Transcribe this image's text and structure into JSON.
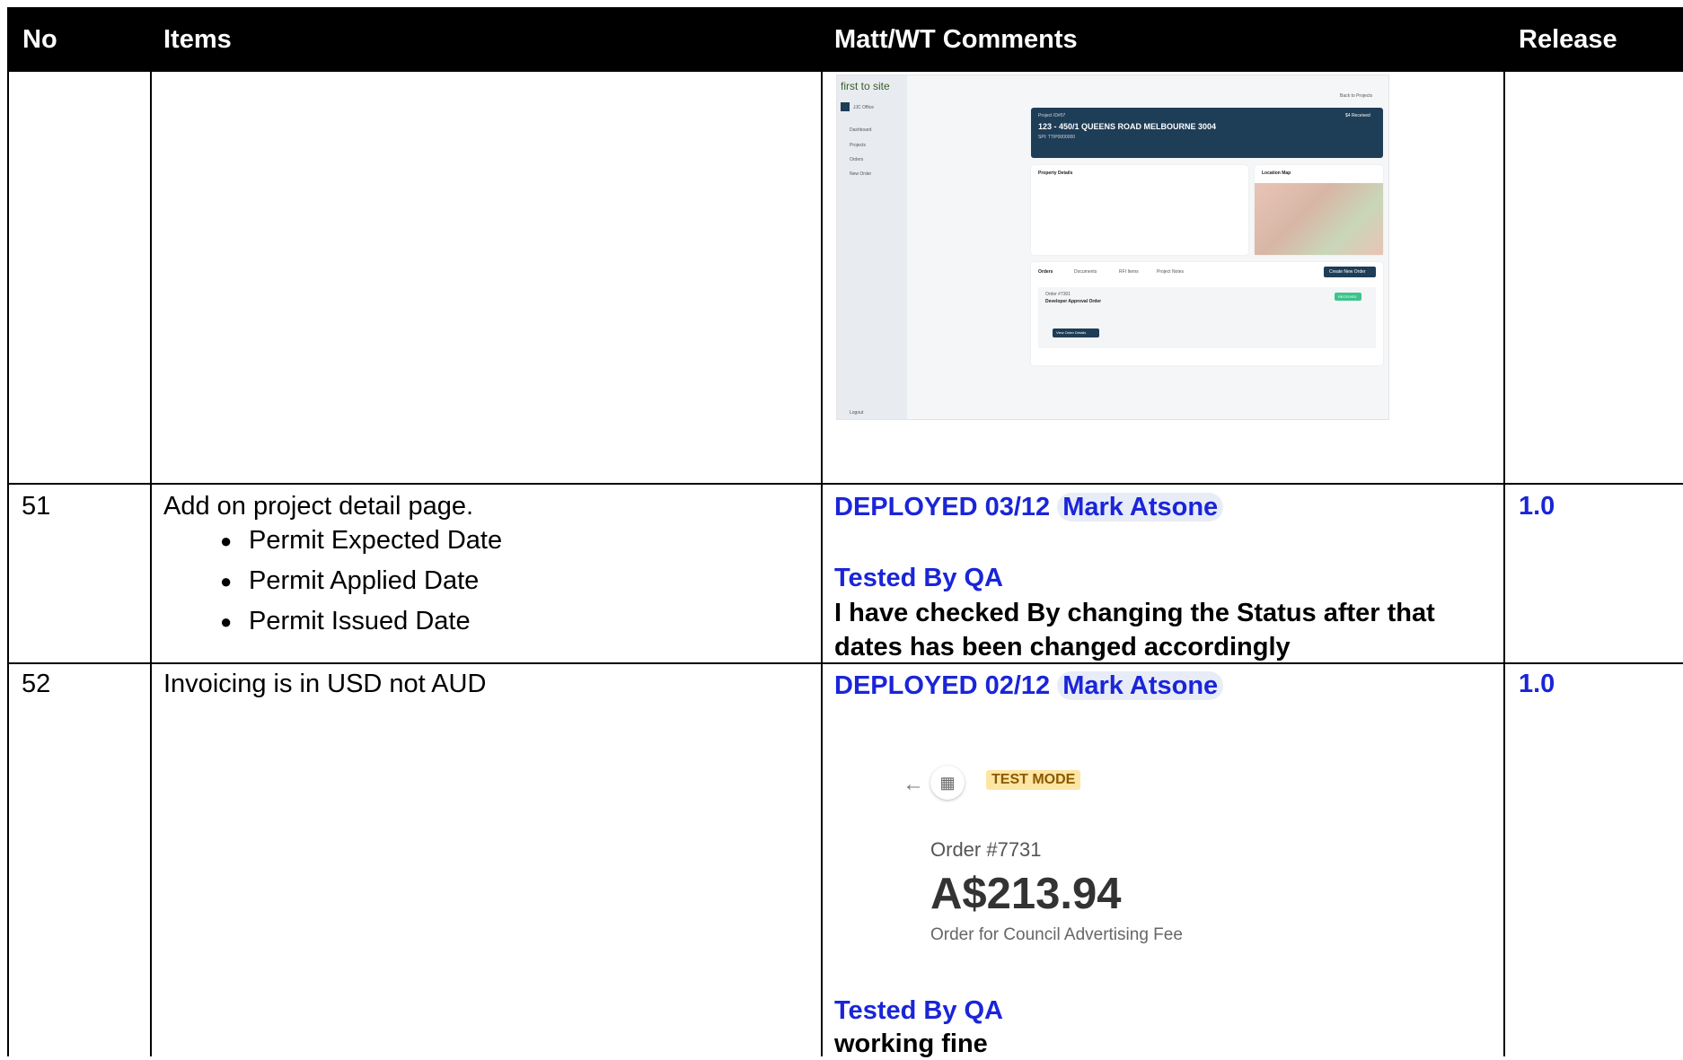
{
  "header": {
    "no": "No",
    "items": "Items",
    "comments": "Matt/WT Comments",
    "release": "Release"
  },
  "screenshot": {
    "brand": "first to site",
    "org": "JJC Office",
    "nav": [
      "Dashboard",
      "Projects",
      "Orders",
      "New Order"
    ],
    "logout": "Logout",
    "back": "Back to Projects",
    "project_label": "Project ID#07",
    "project_title": "123 - 450/1 QUEENS ROAD MELBOURNE 3004",
    "project_sub": "SPI: TTIP0000000",
    "received": "$4 Received",
    "property_details": "Property Details",
    "location_map": "Location Map",
    "tabs": [
      "Orders",
      "Documents",
      "RFI Items",
      "Project Notes"
    ],
    "create_order": "Create New Order",
    "order_label": "Order #7301",
    "order_name": "Developer Approval Order",
    "status": "RECEIVED",
    "view_order": "View Order Details"
  },
  "rows": [
    {
      "no": "51",
      "item_title": "Add on project detail page.",
      "bullets": [
        "Permit Expected Date",
        "Permit Applied Date",
        "Permit Issued Date"
      ],
      "deployed": "DEPLOYED 03/12",
      "person": "Mark Atsone",
      "tested": "Tested By QA",
      "comment": "I have checked By changing the Status after that dates has been changed accordingly",
      "release": "1.0"
    },
    {
      "no": "52",
      "item_title": "Invoicing is in USD not AUD",
      "deployed": "DEPLOYED 02/12",
      "person": "Mark Atsone",
      "tested": "Tested By QA",
      "comment": "working fine",
      "release": "1.0"
    }
  ],
  "payment": {
    "back_icon": "arrow-left-icon",
    "store_icon": "store-icon",
    "badge": "TEST MODE",
    "order": "Order #7731",
    "amount": "A$213.94",
    "description": "Order for Council Advertising Fee"
  }
}
